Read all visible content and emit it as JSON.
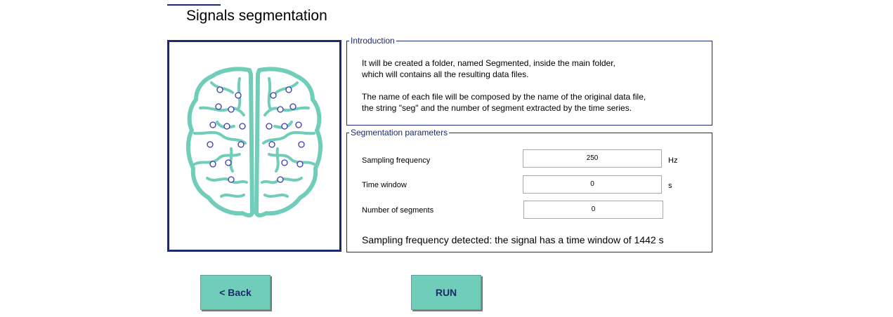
{
  "page": {
    "title": "Signals segmentation"
  },
  "image": {
    "icon": "brain-icon",
    "accent": "#70cdb9",
    "electrode_color": "#3b3bb3"
  },
  "introduction": {
    "legend": "Introduction",
    "lines": [
      "It will be created a folder, named Segmented, inside the main folder,",
      "which will contains all the resulting data files.",
      "The name of each file will be composed by the name of the original data file,",
      "the string \"seg\" and the number of segment extracted by the time series."
    ]
  },
  "parameters": {
    "legend": "Segmentation parameters",
    "sampling_frequency": {
      "label": "Sampling frequency",
      "value": "250",
      "unit": "Hz"
    },
    "time_window": {
      "label": "Time window",
      "value": "0",
      "unit": "s"
    },
    "number_of_segments": {
      "label": "Number of segments",
      "value": "0"
    },
    "detected_message": "Sampling frequency detected: the signal has a time window of 1442 s"
  },
  "buttons": {
    "back": "<  Back",
    "run": "RUN"
  },
  "colors": {
    "navy": "#1c2a6e",
    "button": "#70cdb9"
  }
}
